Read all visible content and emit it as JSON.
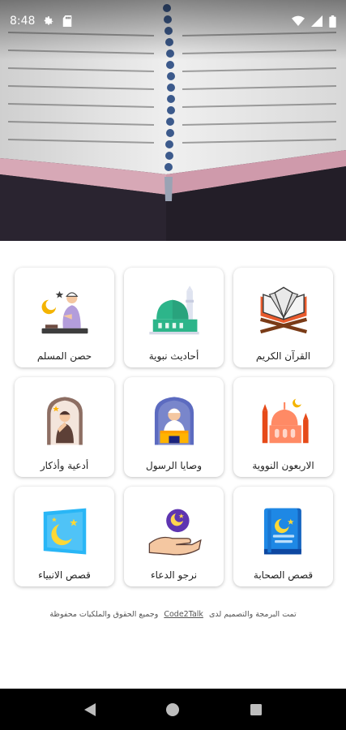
{
  "status": {
    "time": "8:48"
  },
  "cards": [
    {
      "label": "القرآن الكريم",
      "icon": "quran-book-icon"
    },
    {
      "label": "أحاديث نبوية",
      "icon": "mosque-icon"
    },
    {
      "label": "حصن المسلم",
      "icon": "praying-man-icon"
    },
    {
      "label": "الاربعون النووية",
      "icon": "mosque-domes-icon"
    },
    {
      "label": "وصايا الرسول",
      "icon": "preacher-icon"
    },
    {
      "label": "أدعية وأذكار",
      "icon": "dua-man-icon"
    },
    {
      "label": "قصص الصحابة",
      "icon": "storybook-icon"
    },
    {
      "label": "نرجو الدعاء",
      "icon": "hand-moon-icon"
    },
    {
      "label": "قصص الانبياء",
      "icon": "moon-card-icon"
    }
  ],
  "footer": {
    "prefix": "تمت البرمجة والتصميم لدى",
    "brand": "Code2Talk",
    "suffix": "وجميع الحقوق والملكيات محفوظة"
  }
}
